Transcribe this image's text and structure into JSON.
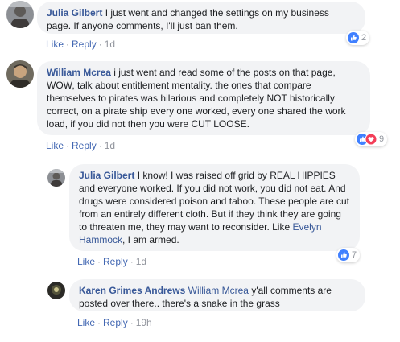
{
  "comments": [
    {
      "author": "Julia Gilbert",
      "text": "I just went and changed the settings on my business page. If anyone comments, I'll just ban them.",
      "like": "Like",
      "reply": "Reply",
      "time": "1d",
      "reaction_count": "2",
      "reactions": [
        "like-icon"
      ]
    },
    {
      "author": "William Mcrea",
      "text": "i just went and read some of the posts on that page, WOW, talk about entitlement mentality. the ones that compare themselves to pirates was hilarious and completely NOT historically correct, on a pirate ship every one worked, every one shared the work load, if you did not then you were CUT LOOSE.",
      "like": "Like",
      "reply": "Reply",
      "time": "1d",
      "reaction_count": "9",
      "reactions": [
        "like-icon",
        "love-icon"
      ]
    },
    {
      "author": "Julia Gilbert",
      "text_before": "I know! I was raised off grid by REAL HIPPIES and everyone worked. If you did not work, you did not eat. And drugs were considered poison and taboo. These people are cut from an entirely different cloth. But if they think they are going to threaten me, they may want to reconsider. Like",
      "mention": "Evelyn Hammock",
      "text_after": ", I am armed.",
      "like": "Like",
      "reply": "Reply",
      "time": "1d",
      "reaction_count": "7",
      "reactions": [
        "like-icon"
      ]
    },
    {
      "author": "Karen Grimes Andrews",
      "mention": "William Mcrea",
      "text": "y'all comments are posted over there.. there's a snake in the grass",
      "like": "Like",
      "reply": "Reply",
      "time": "19h"
    }
  ],
  "colors": {
    "link": "#385898",
    "action": "#4267b2",
    "bubble": "#f2f3f5",
    "like_blue": "#4080ff",
    "love_red": "#f33e58"
  }
}
